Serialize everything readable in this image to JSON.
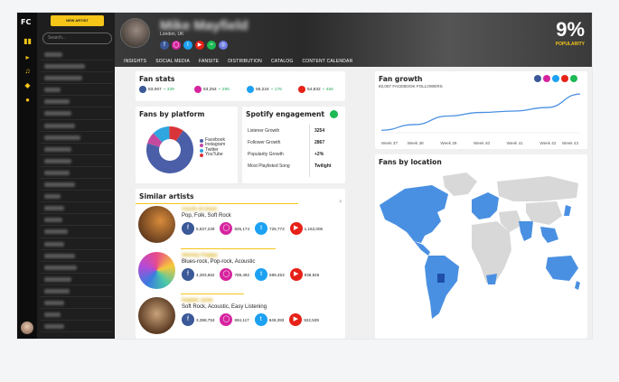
{
  "app": {
    "logo": "FC"
  },
  "rail": {
    "icons": [
      "chart-icon",
      "megaphone-icon",
      "music-note-icon",
      "tag-icon",
      "user-icon"
    ]
  },
  "sidebar": {
    "new_button": "NEW ARTIST",
    "search_placeholder": "Search..."
  },
  "header": {
    "artist_name": "Mike Mayfield",
    "location": "London, UK",
    "popularity_value": "9%",
    "popularity_label": "POPULARITY",
    "tabs": [
      "INSIGHTS",
      "SOCIAL MEDIA",
      "FANSITE",
      "DISTRIBUTION",
      "CATALOG",
      "CONTENT CALENDAR"
    ],
    "active_tab": "INSIGHTS"
  },
  "fan_stats": {
    "title": "Fan stats",
    "items": [
      {
        "platform": "facebook",
        "value": "83,067",
        "delta": "+ 339"
      },
      {
        "platform": "instagram",
        "value": "63,254",
        "delta": "+ 295"
      },
      {
        "platform": "twitter",
        "value": "55,224",
        "delta": "+ 176"
      },
      {
        "platform": "youtube",
        "value": "54,832",
        "delta": "+ 456"
      }
    ]
  },
  "fans_by_platform": {
    "title": "Fans by platform",
    "legend": [
      "Facebook",
      "Instagram",
      "Twitter",
      "YouTube"
    ],
    "colors": [
      "#4a5fa8",
      "#c44aa0",
      "#2fa6e0",
      "#d9343a"
    ],
    "values": [
      70,
      8,
      12,
      10
    ]
  },
  "spotify": {
    "title": "Spotify engagement",
    "rows": [
      {
        "label": "Listener Growth",
        "value": "3254"
      },
      {
        "label": "Follower Growth",
        "value": "2867"
      },
      {
        "label": "Popularity Growth",
        "value": "+2%"
      },
      {
        "label": "Most Playlisted Song",
        "value": "Twilight"
      }
    ]
  },
  "fan_growth": {
    "title": "Fan growth",
    "subtitle": "83,067 FACEBOOK FOLLOWERS",
    "weeks": [
      "Week 37",
      "Week 38",
      "Week 39",
      "Week 40",
      "Week 41",
      "Week 42",
      "Week 43"
    ]
  },
  "chart_data": {
    "type": "line",
    "x": [
      "Week 37",
      "Week 38",
      "Week 39",
      "Week 40",
      "Week 41",
      "Week 42",
      "Week 43"
    ],
    "series": [
      {
        "values": [
          1,
          9,
          21,
          26,
          28,
          33,
          52
        ]
      }
    ],
    "ylabel": "",
    "grid": false
  },
  "fans_by_location": {
    "title": "Fans by location"
  },
  "similar_artists": {
    "title": "Similar artists",
    "artists": [
      {
        "name": "Circle of Dust",
        "genres": "Pop, Folk, Soft Rock",
        "fb": "5,837,229",
        "ig": "825,174",
        "tw": "725,773",
        "yt": "1,162,005"
      },
      {
        "name": "Skinny Puppy",
        "genres": "Blues-rock, Pop-rock, Acoustic",
        "fb": "4,283,662",
        "ig": "789,492",
        "tw": "699,453",
        "yt": "938,945"
      },
      {
        "name": "Rabbit Junk",
        "genres": "Soft Rock, Acoustic, Easy Listening",
        "fb": "3,398,753",
        "ig": "694,117",
        "tw": "649,393",
        "yt": "822,539"
      }
    ]
  }
}
